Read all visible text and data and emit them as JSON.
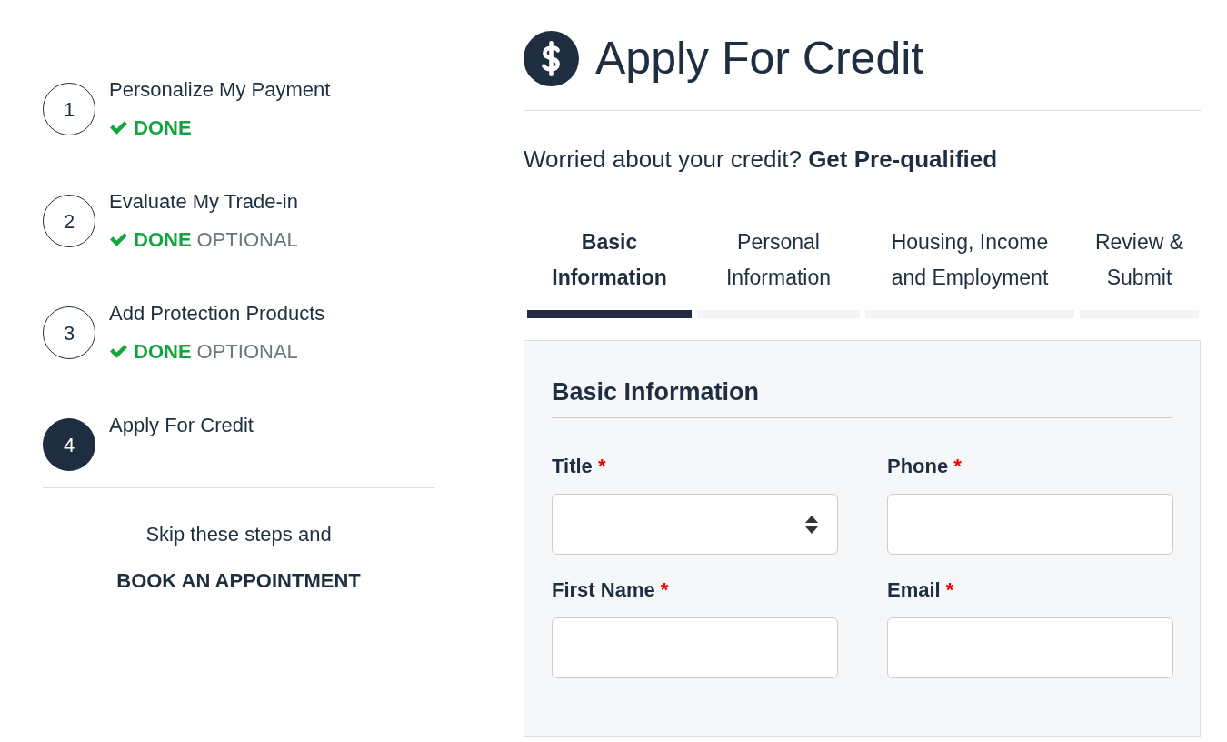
{
  "steps": [
    {
      "number": "1",
      "title": "Personalize My Payment",
      "current": false,
      "done": true,
      "status": "DONE"
    },
    {
      "number": "2",
      "title": "Evaluate My Trade-in",
      "current": false,
      "done": true,
      "status": "DONE",
      "note": "OPTIONAL"
    },
    {
      "number": "3",
      "title": "Add Protection Products",
      "current": false,
      "done": true,
      "status": "DONE",
      "note": "OPTIONAL"
    },
    {
      "number": "4",
      "title": "Apply For Credit",
      "current": true,
      "done": false
    }
  ],
  "skip": {
    "text": "Skip these steps and",
    "link": "BOOK AN APPOINTMENT"
  },
  "page_title": "Apply For Credit",
  "prequalify": {
    "text": "Worried about your credit?",
    "link": "Get Pre-qualified"
  },
  "tabs": [
    {
      "label": "Basic Information",
      "selected": true
    },
    {
      "label": "Personal Information",
      "selected": false
    },
    {
      "label": "Housing, Income and Employment",
      "selected": false
    },
    {
      "label": "Review & Submit",
      "selected": false
    }
  ],
  "form": {
    "title": "Basic Information",
    "fields": [
      {
        "label": "Title",
        "required_mark": "*",
        "kind": "select"
      },
      {
        "label": "Phone",
        "required_mark": "*",
        "kind": "text"
      },
      {
        "label": "First Name",
        "required_mark": "*",
        "kind": "text"
      },
      {
        "label": "Email",
        "required_mark": "*",
        "kind": "text"
      }
    ]
  }
}
